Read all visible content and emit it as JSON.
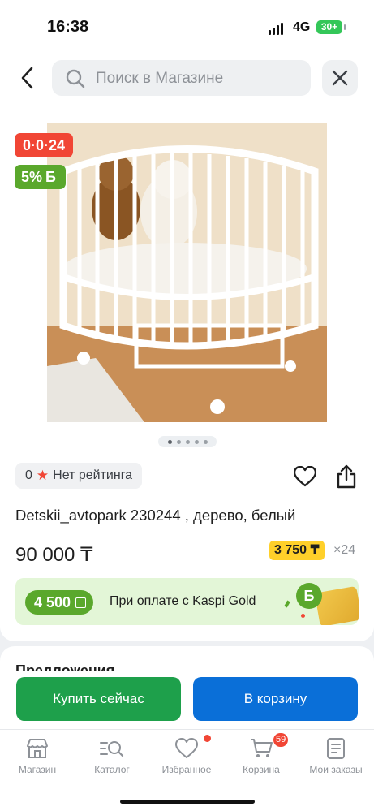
{
  "status_bar": {
    "time": "16:38",
    "network": "4G",
    "battery": "30+"
  },
  "header": {
    "search_placeholder": "Поиск в Магазине"
  },
  "product": {
    "timer_badge": "0·0·24",
    "discount_badge": "5%",
    "discount_symbol": "Б",
    "carousel": {
      "count": 5,
      "active": 1
    },
    "rating_value": "0",
    "rating_text": "Нет рейтинга",
    "title": "Detskii_avtopark 230244 , дерево, белый",
    "price": "90 000 ₸",
    "monthly_payment": "3 750 ₸",
    "months": "×24"
  },
  "promo": {
    "bonus_amount": "4 500",
    "text": "При оплате с Kaspi Gold",
    "coin_symbol": "Б"
  },
  "next_section": {
    "title_peek": "Предложения"
  },
  "actions": {
    "buy_now": "Купить сейчас",
    "add_to_cart": "В корзину"
  },
  "tabbar": {
    "shop": "Магазин",
    "catalog": "Каталог",
    "favorites": "Избранное",
    "cart": "Корзина",
    "cart_count": "59",
    "orders": "Мои заказы"
  },
  "colors": {
    "accent_red": "#f14635",
    "kaspi_green": "#5aa82c",
    "buy_green": "#1ea04b",
    "cart_blue": "#0a6fd8",
    "installment_yellow": "#ffd02a"
  }
}
